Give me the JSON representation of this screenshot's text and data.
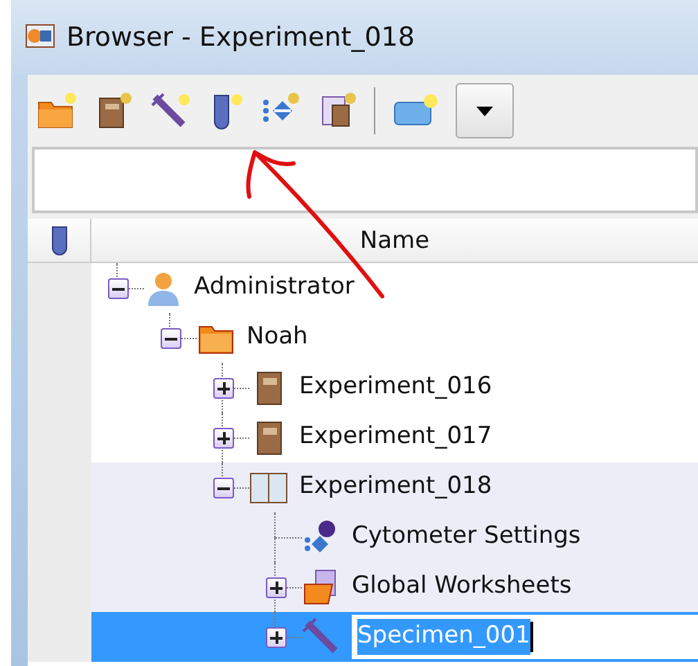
{
  "window": {
    "title": "Browser - Experiment_018"
  },
  "grid": {
    "columns": [
      {
        "label": "Name"
      }
    ],
    "tree": [
      {
        "label": "Administrator",
        "kind": "user",
        "expanded": true,
        "selected": false,
        "highlighted": false,
        "children": [
          {
            "label": "Noah",
            "kind": "folder",
            "expanded": true,
            "selected": false,
            "highlighted": false,
            "children": [
              {
                "label": "Experiment_016",
                "kind": "experiment",
                "expanded": false,
                "selected": false,
                "highlighted": false
              },
              {
                "label": "Experiment_017",
                "kind": "experiment",
                "expanded": false,
                "selected": false,
                "highlighted": false
              },
              {
                "label": "Experiment_018",
                "kind": "experiment",
                "expanded": true,
                "selected": false,
                "highlighted": true,
                "children": [
                  {
                    "label": "Cytometer Settings",
                    "kind": "settings",
                    "selected": false,
                    "highlighted": true
                  },
                  {
                    "label": "Global Worksheets",
                    "kind": "worksheets",
                    "expanded": false,
                    "selected": false,
                    "highlighted": true
                  },
                  {
                    "label": "Specimen_001",
                    "kind": "specimen",
                    "expanded": false,
                    "selected": true,
                    "editing": true
                  }
                ]
              }
            ]
          }
        ]
      }
    ]
  }
}
